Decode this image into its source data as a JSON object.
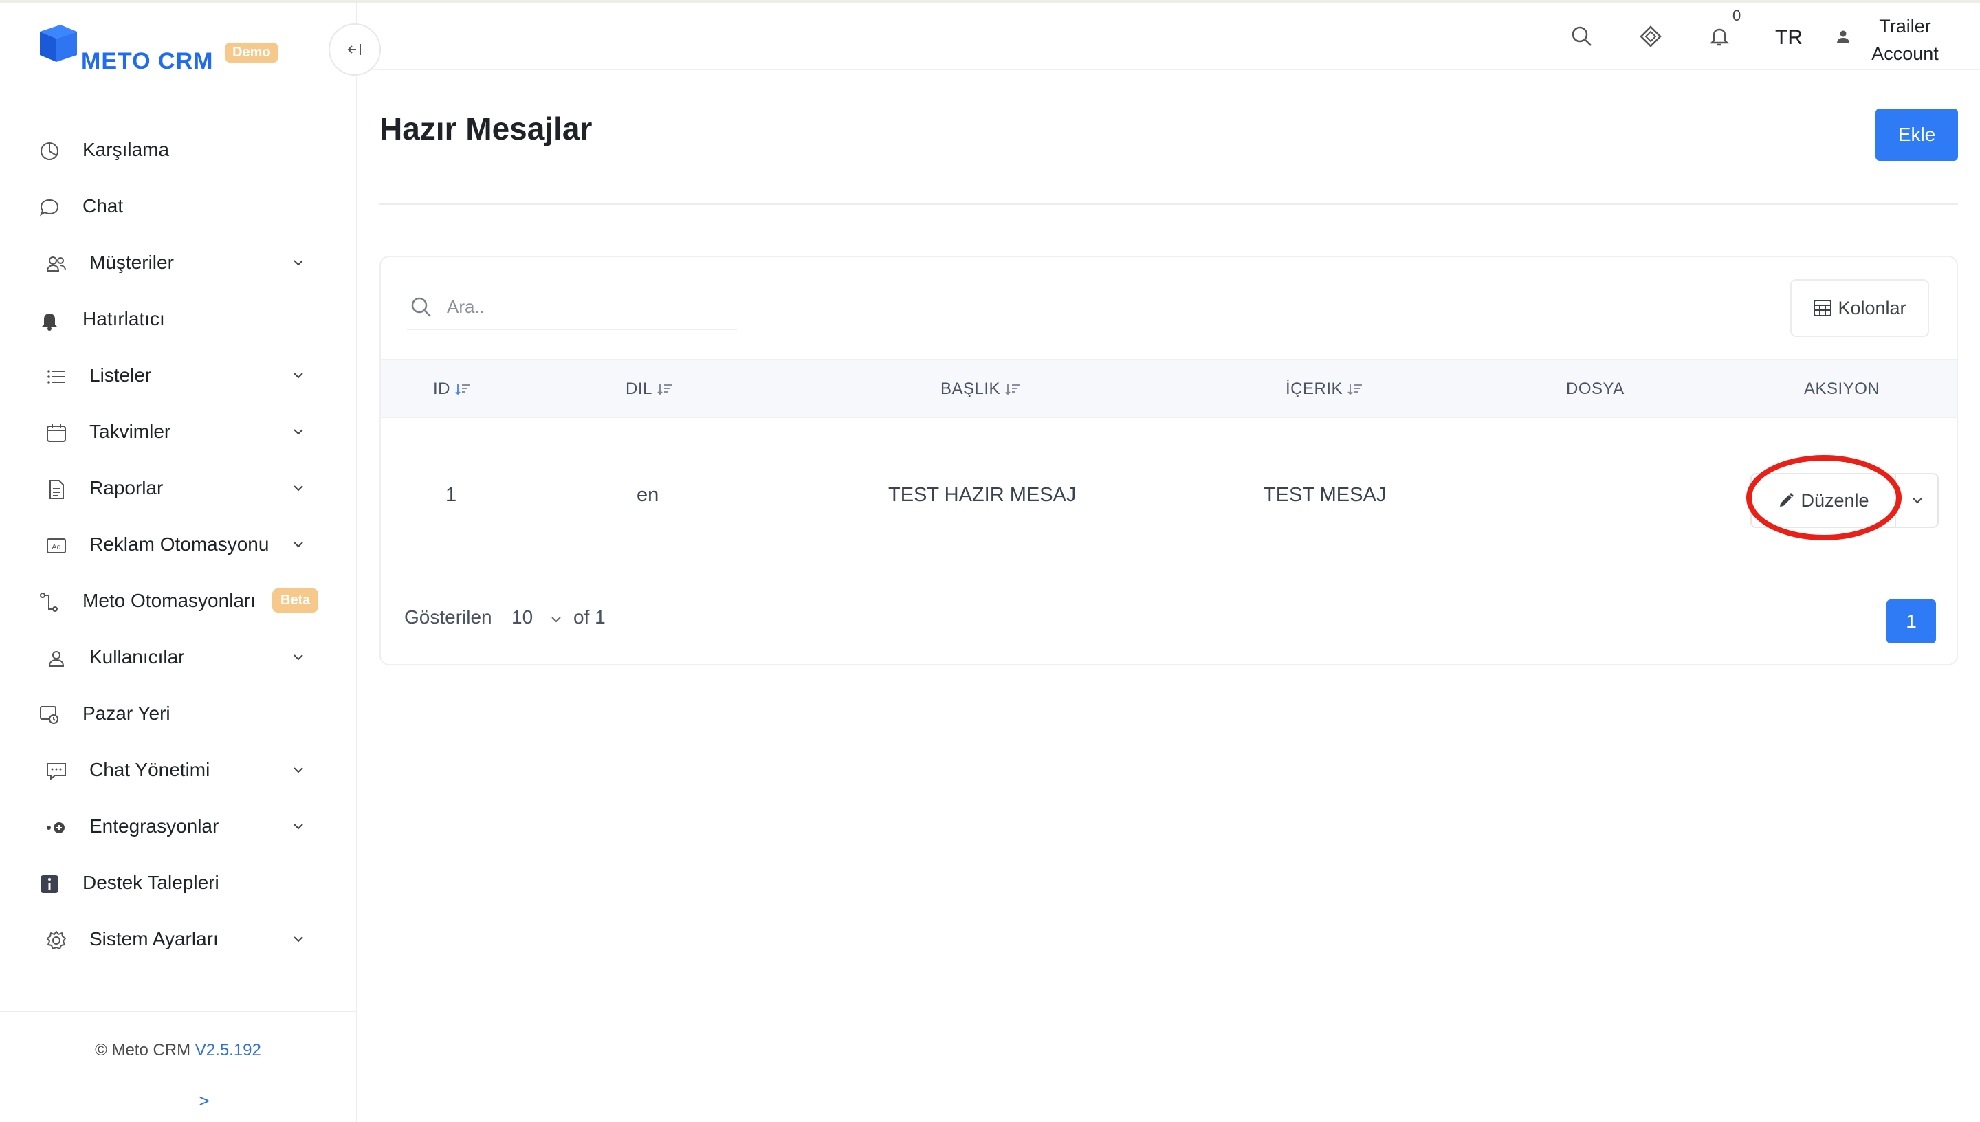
{
  "brand": {
    "name": "METO CRM",
    "badge": "Demo"
  },
  "sidebar": {
    "items": [
      {
        "label": "Karşılama",
        "icon": "chart-pie-icon",
        "has_submenu": false
      },
      {
        "label": "Chat",
        "icon": "chat-bubble-icon",
        "has_submenu": false
      },
      {
        "label": "Müşteriler",
        "icon": "users-icon",
        "has_submenu": true
      },
      {
        "label": "Hatırlatıcı",
        "icon": "bell-icon",
        "has_submenu": false
      },
      {
        "label": "Listeler",
        "icon": "list-icon",
        "has_submenu": true
      },
      {
        "label": "Takvimler",
        "icon": "calendar-icon",
        "has_submenu": true
      },
      {
        "label": "Raporlar",
        "icon": "report-icon",
        "has_submenu": true
      },
      {
        "label": "Reklam Otomasyonu",
        "icon": "ad-icon",
        "has_submenu": true
      },
      {
        "label": "Meto Otomasyonları",
        "icon": "flow-icon",
        "has_submenu": false,
        "badge": "Beta"
      },
      {
        "label": "Kullanıcılar",
        "icon": "user-icon",
        "has_submenu": true
      },
      {
        "label": "Pazar Yeri",
        "icon": "marketplace-icon",
        "has_submenu": false
      },
      {
        "label": "Chat Yönetimi",
        "icon": "chat-manage-icon",
        "has_submenu": true
      },
      {
        "label": "Entegrasyonlar",
        "icon": "integration-icon",
        "has_submenu": true
      },
      {
        "label": "Destek Talepleri",
        "icon": "info-icon",
        "has_submenu": false
      },
      {
        "label": "Sistem Ayarları",
        "icon": "gear-icon",
        "has_submenu": true
      }
    ],
    "footer": {
      "copyright": "© Meto CRM",
      "version": "V2.5.192",
      "expand": ">"
    }
  },
  "header": {
    "notification_count": "0",
    "language": "TR",
    "account_line1": "Trailer",
    "account_line2": "Account"
  },
  "page": {
    "title": "Hazır Mesajlar",
    "add_label": "Ekle"
  },
  "table": {
    "search_placeholder": "Ara..",
    "columns_label": "Kolonlar",
    "headers": [
      "ID",
      "DIL",
      "BAŞLIK",
      "İÇERIK",
      "DOSYA",
      "AKSIYON"
    ],
    "rows": [
      {
        "id": "1",
        "lang": "en",
        "title": "TEST HAZIR MESAJ",
        "content": "TEST MESAJ",
        "file": ""
      }
    ],
    "edit_label": "Düzenle"
  },
  "pagination": {
    "shown_label": "Gösterilen",
    "page_size": "10",
    "of_label": "of 1",
    "current_page": "1"
  },
  "colors": {
    "accent": "#2f7bf5",
    "brand": "#1f6bf2",
    "badge": "#f6c88a",
    "highlight": "#ea1f15"
  }
}
